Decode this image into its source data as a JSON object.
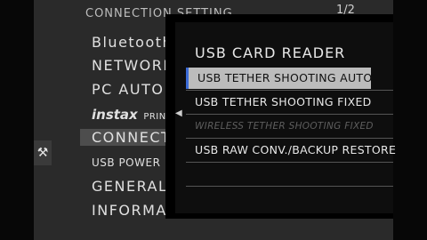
{
  "header": {
    "title": "CONNECTION SETTING",
    "page": "1/2"
  },
  "categories": [
    {
      "label": "Bluetooth"
    },
    {
      "label": "NETWORK"
    },
    {
      "label": "PC AUTO"
    },
    {
      "label": "instax",
      "sub": "PRINTER"
    },
    {
      "label": "CONNECT"
    },
    {
      "label": "USB POWER"
    },
    {
      "label": "GENERAL"
    },
    {
      "label": "INFORMA"
    }
  ],
  "submenu": {
    "title": "USB CARD READER",
    "items": [
      {
        "label": "USB TETHER SHOOTING AUTO",
        "state": "selected"
      },
      {
        "label": "USB TETHER SHOOTING FIXED",
        "state": "normal"
      },
      {
        "label": "WIRELESS TETHER SHOOTING FIXED",
        "state": "disabled"
      },
      {
        "label": "USB RAW CONV./BACKUP RESTORE",
        "state": "normal"
      }
    ]
  },
  "icons": {
    "tab": "wrench-icon",
    "back": "arrow-left-icon"
  },
  "colors": {
    "highlight": "#bcbcbc",
    "accent": "#3b6bd6"
  }
}
